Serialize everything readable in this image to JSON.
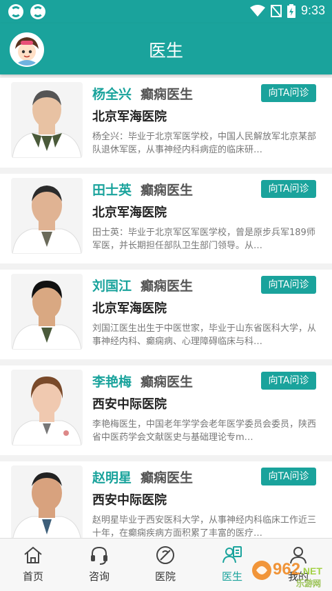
{
  "status": {
    "time": "9:33"
  },
  "header": {
    "title": "医生"
  },
  "consult_label": "向TA问诊",
  "doctors": [
    {
      "name": "杨全兴",
      "specialty": "癫痫医生",
      "hospital": "北京军海医院",
      "bio": "杨全兴：毕业于北京军医学校，中国人民解放军北京某部队退休军医，从事神经内科病症的临床研…"
    },
    {
      "name": "田士英",
      "specialty": "癫痫医生",
      "hospital": "北京军海医院",
      "bio": "田士英：毕业于北京军区军医学校，曾是原步兵军189师军医，并长期担任部队卫生部门领导。从…"
    },
    {
      "name": "刘国江",
      "specialty": "癫痫医生",
      "hospital": "北京军海医院",
      "bio": "刘国江医生出生于中医世家，毕业于山东省医科大学，从事神经内科、癫痫病、心理障碍临床与科…"
    },
    {
      "name": "李艳梅",
      "specialty": "癫痫医生",
      "hospital": "西安中际医院",
      "bio": "李艳梅医生，中国老年学学会老年医学委员会委员，陕西省中医药学会文献医史与基础理论专m…"
    },
    {
      "name": "赵明星",
      "specialty": "癫痫医生",
      "hospital": "西安中际医院",
      "bio": "赵明星毕业于西安医科大学，从事神经内科临床工作近三十年，在癫痫疾病方面积累了丰富的医疗…"
    }
  ],
  "tabs": [
    {
      "label": "首页",
      "icon": "home-icon"
    },
    {
      "label": "咨询",
      "icon": "headset-icon"
    },
    {
      "label": "医院",
      "icon": "hospital-icon"
    },
    {
      "label": "医生",
      "icon": "doctor-icon"
    },
    {
      "label": "我的",
      "icon": "person-icon"
    }
  ],
  "watermark": {
    "brand": "962",
    "suffix": ".NET",
    "sub": "乐游网"
  },
  "colors": {
    "accent": "#1aa39c"
  }
}
